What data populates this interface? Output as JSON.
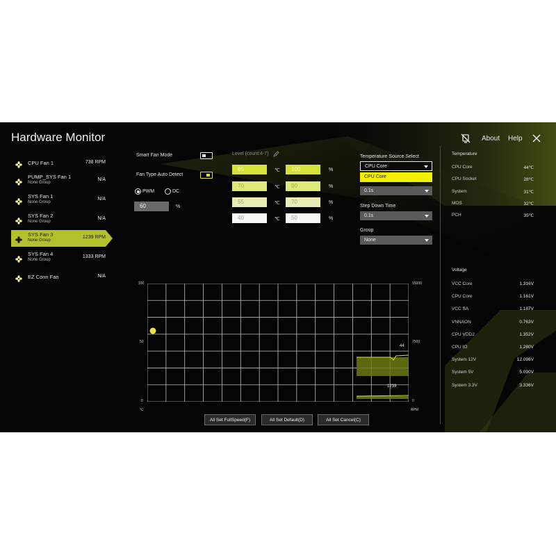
{
  "app": {
    "title": "Hardware Monitor"
  },
  "header": {
    "about": "About",
    "help": "Help"
  },
  "fans": [
    {
      "name": "CPU Fan 1",
      "group": "",
      "rpm": "738 RPM",
      "active": false
    },
    {
      "name": "PUMP_SYS Fan 1",
      "group": "None Group",
      "rpm": "N/A",
      "active": false
    },
    {
      "name": "SYS Fan 1",
      "group": "None Group",
      "rpm": "N/A",
      "active": false
    },
    {
      "name": "SYS Fan 2",
      "group": "None Group",
      "rpm": "N/A",
      "active": false
    },
    {
      "name": "SYS Fan 3",
      "group": "None Group",
      "rpm": "1239 RPM",
      "active": true
    },
    {
      "name": "SYS Fan 4",
      "group": "None Group",
      "rpm": "1333 RPM",
      "active": false
    },
    {
      "name": "EZ Conn Fan",
      "group": "",
      "rpm": "N/A",
      "active": false
    }
  ],
  "controls": {
    "smart_fan_mode": "Smart Fan Mode",
    "smart_fan_mode_on": false,
    "fan_type_auto_detect": "Fan Type Auto Detect",
    "fan_type_auto_detect_on": true,
    "pwm": "PWM",
    "dc": "DC",
    "pwm_selected": true,
    "speed_value": "60",
    "speed_unit": "%",
    "level_label": "Level (count:4-7)",
    "temp_unit": "℃",
    "pct_unit": "%",
    "levels": [
      {
        "temp": "85",
        "pct": "100"
      },
      {
        "temp": "70",
        "pct": "90"
      },
      {
        "temp": "55",
        "pct": "70"
      },
      {
        "temp": "40",
        "pct": "50"
      }
    ]
  },
  "temp_source": {
    "label": "Temperature Source Select",
    "selected": "CPU Core",
    "option_highlighted": "CPU Core",
    "step_up_value": "0.1s",
    "step_down_label": "Step Down Time",
    "step_down_value": "0.1s",
    "group_label": "Group",
    "group_value": "None"
  },
  "temperature": {
    "heading": "Temperature",
    "items": [
      {
        "label": "CPU Core",
        "value": "44℃"
      },
      {
        "label": "CPU Socket",
        "value": "28℃"
      },
      {
        "label": "System",
        "value": "31℃"
      },
      {
        "label": "MOS",
        "value": "32℃"
      },
      {
        "label": "PCH",
        "value": "35℃"
      }
    ]
  },
  "voltage": {
    "heading": "Voltage",
    "items": [
      {
        "label": "VCC Core",
        "value": "1.316V"
      },
      {
        "label": "CPU Core",
        "value": "1.161V"
      },
      {
        "label": "VCC SA",
        "value": "1.187V"
      },
      {
        "label": "VNNAON",
        "value": "0.763V"
      },
      {
        "label": "CPU VDD2",
        "value": "1.352V"
      },
      {
        "label": "CPU IO",
        "value": "1.280V"
      },
      {
        "label": "System 12V",
        "value": "12.096V"
      },
      {
        "label": "System 5V",
        "value": "5.090V"
      },
      {
        "label": "System 3.3V",
        "value": "3.336V"
      }
    ]
  },
  "graph": {
    "left_top": "100",
    "left_mid": "50",
    "left_bottom": "0",
    "left_unit": "℃",
    "right_top": "15000",
    "right_mid": "7500",
    "right_bottom": "0",
    "right_unit": "RPM",
    "temp_readout": "44",
    "rpm_readout": "1239",
    "point_value": 60
  },
  "buttons": {
    "full_speed": "All Set FullSpeed(F)",
    "default": "All Set Default(D)",
    "cancel": "All Set Cancel(C)"
  },
  "colors": {
    "accent": "#d6e23c",
    "highlight": "#b3c12c"
  }
}
